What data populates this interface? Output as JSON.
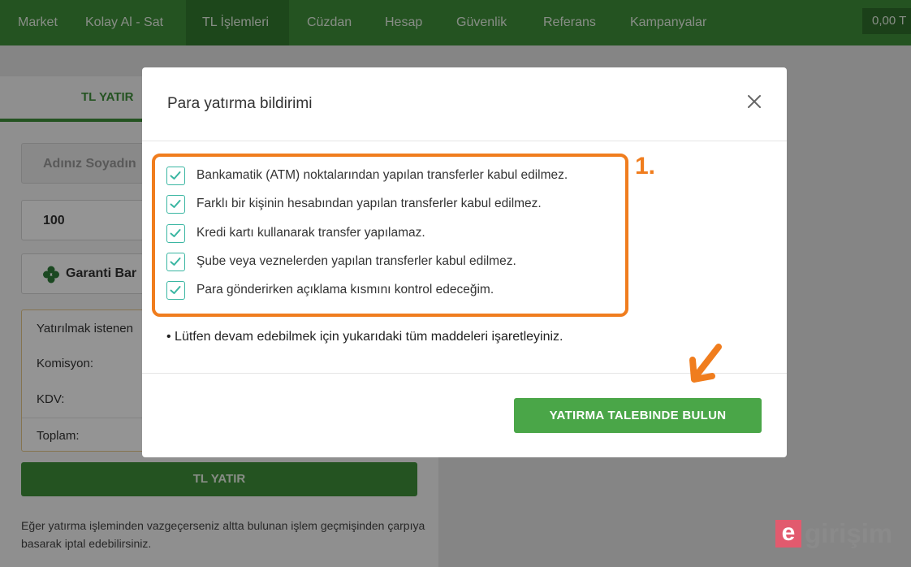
{
  "nav": {
    "items": [
      {
        "label": "Market"
      },
      {
        "label": "Kolay Al - Sat"
      },
      {
        "label": "TL İşlemleri"
      },
      {
        "label": "Cüzdan"
      },
      {
        "label": "Hesap"
      },
      {
        "label": "Güvenlik"
      },
      {
        "label": "Referans"
      },
      {
        "label": "Kampanyalar"
      }
    ],
    "active": "TL İşlemleri",
    "balance": "0,00 T"
  },
  "background_form": {
    "tab_label": "TL YATIR",
    "name_placeholder": "Adınız Soyadın",
    "amount_value": "100",
    "bank_value": "Garanti Bar",
    "summary_rows": [
      "Yatırılmak istenen",
      "Komisyon:",
      "KDV:",
      "Toplam:"
    ],
    "submit_label": "TL YATIR",
    "note": "Eğer yatırma işleminden vazgeçerseniz altta bulunan işlem geçmişinden çarpıya basarak iptal edebilirsiniz."
  },
  "modal": {
    "title": "Para yatırma bildirimi",
    "checklist": [
      {
        "label": "Bankamatik (ATM) noktalarından yapılan transferler kabul edilmez.",
        "checked": true
      },
      {
        "label": "Farklı bir kişinin hesabından yapılan transferler kabul edilmez.",
        "checked": true
      },
      {
        "label": "Kredi kartı kullanarak transfer yapılamaz.",
        "checked": true
      },
      {
        "label": "Şube veya veznelerden yapılan transferler kabul edilmez.",
        "checked": true
      },
      {
        "label": "Para gönderirken açıklama kısmını kontrol edeceğim.",
        "checked": true
      }
    ],
    "step_annotation": "1.",
    "note": "• Lütfen devam edebilmek için yukarıdaki tüm maddeleri işaretleyiniz.",
    "submit_label": "YATIRMA TALEBINDE BULUN"
  },
  "watermark": {
    "letter": "e",
    "text": "girişim"
  },
  "colors": {
    "nav_green": "#3f8f3a",
    "button_green": "#4aa648",
    "checkbox_teal": "#3ab6a2",
    "annotation_orange": "#f07d1e"
  }
}
